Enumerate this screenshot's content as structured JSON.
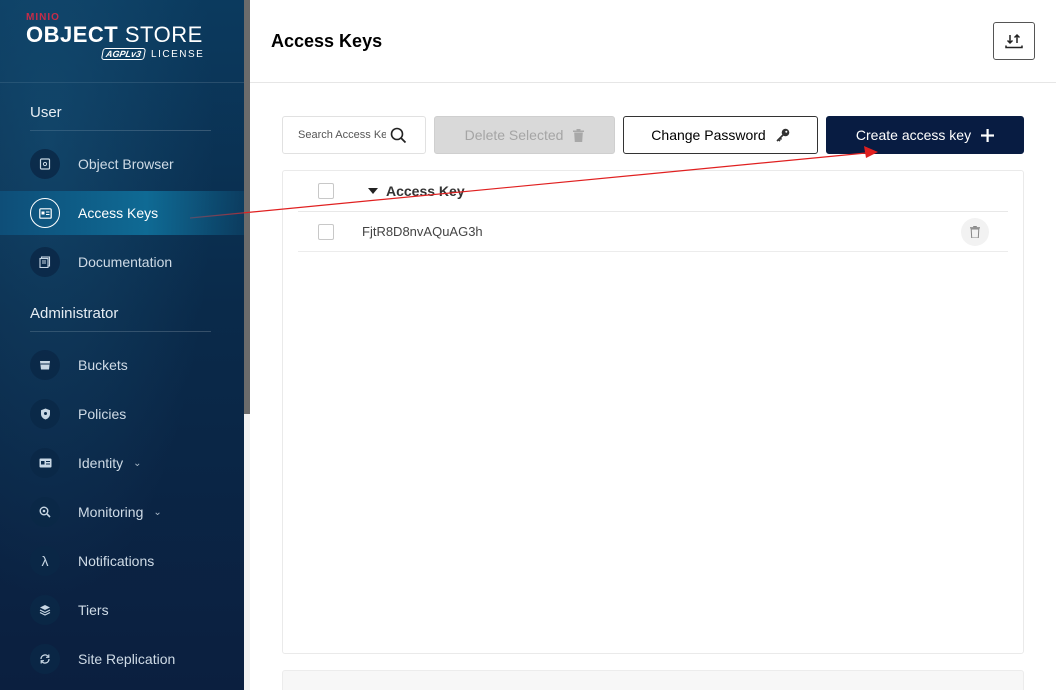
{
  "brand": {
    "vendor": "MINIO",
    "product_bold": "OBJECT",
    "product_thin": "STORE",
    "badge": "AGPLv3",
    "license": "LICENSE"
  },
  "sidebar": {
    "sections": [
      {
        "title": "User"
      },
      {
        "title": "Administrator"
      }
    ],
    "items": [
      {
        "label": "Object Browser",
        "icon": "object-browser-icon",
        "active": false
      },
      {
        "label": "Access Keys",
        "icon": "access-keys-icon",
        "active": true
      },
      {
        "label": "Documentation",
        "icon": "documentation-icon",
        "active": false
      },
      {
        "label": "Buckets",
        "icon": "bucket-icon",
        "active": false
      },
      {
        "label": "Policies",
        "icon": "shield-icon",
        "active": false
      },
      {
        "label": "Identity",
        "icon": "identity-icon",
        "active": false,
        "expandable": true
      },
      {
        "label": "Monitoring",
        "icon": "monitoring-icon",
        "active": false,
        "expandable": true
      },
      {
        "label": "Notifications",
        "icon": "lambda-icon",
        "active": false
      },
      {
        "label": "Tiers",
        "icon": "tiers-icon",
        "active": false
      },
      {
        "label": "Site Replication",
        "icon": "replication-icon",
        "active": false
      }
    ]
  },
  "header": {
    "title": "Access Keys"
  },
  "toolbar": {
    "search_placeholder": "Search Access Keys",
    "delete_label": "Delete Selected",
    "change_password_label": "Change Password",
    "create_label": "Create access key"
  },
  "table": {
    "column_header": "Access Key",
    "rows": [
      {
        "access_key": "FjtR8D8nvAQuAG3h"
      }
    ]
  },
  "colors": {
    "sidebar_bg": "#0b2a4a",
    "active_item": "#0f6a94",
    "primary_button": "#081c42",
    "annotation_arrow": "#e02020"
  }
}
